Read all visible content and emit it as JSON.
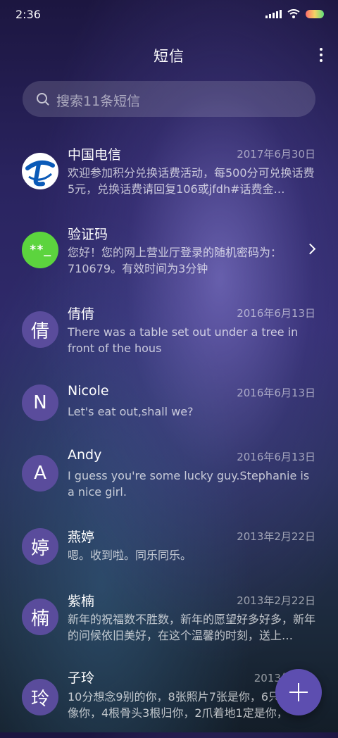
{
  "status_bar": {
    "time": "2:36"
  },
  "header": {
    "title": "短信"
  },
  "search": {
    "placeholder": "搜索11条短信"
  },
  "conversations": [
    {
      "name": "中国电信",
      "date": "2017年6月30日",
      "preview": "欢迎参加积分兑换话费活动，每500分可兑换话费5元，兑换话费请回复106或jfdh#话费金…",
      "avatar": "telecom-logo"
    },
    {
      "name": "验证码",
      "date": "",
      "preview": "您好！您的网上营业厅登录的随机密码为：710679。有效时间为3分钟",
      "avatar": "**_",
      "avatar_color": "#5cd43e"
    },
    {
      "name": "倩倩",
      "date": "2016年6月13日",
      "preview": "There was a table set out under a tree in front of the hous",
      "avatar": "倩"
    },
    {
      "name": "Nicole",
      "date": "2016年6月13日",
      "preview": "Let's eat out,shall we?",
      "avatar": "N"
    },
    {
      "name": "Andy",
      "date": "2016年6月13日",
      "preview": "I guess you're some lucky guy.Stephanie is a nice girl.",
      "avatar": "A"
    },
    {
      "name": "燕婷",
      "date": "2013年2月22日",
      "preview": "嗯。收到啦。同乐同乐。",
      "avatar": "婷"
    },
    {
      "name": "紫楠",
      "date": "2013年2月22日",
      "preview": "新年的祝福数不胜数，新年的愿望好多好多，新年的问候依旧美好，在这个温馨的时刻，送上…",
      "avatar": "楠"
    },
    {
      "name": "子玲",
      "date": "2013年2月2",
      "preview": "10分想念9别的你，8张照片7张是你，6只像你，4根骨头3根归你，2爪着地1定是你，",
      "avatar": "玲"
    }
  ]
}
